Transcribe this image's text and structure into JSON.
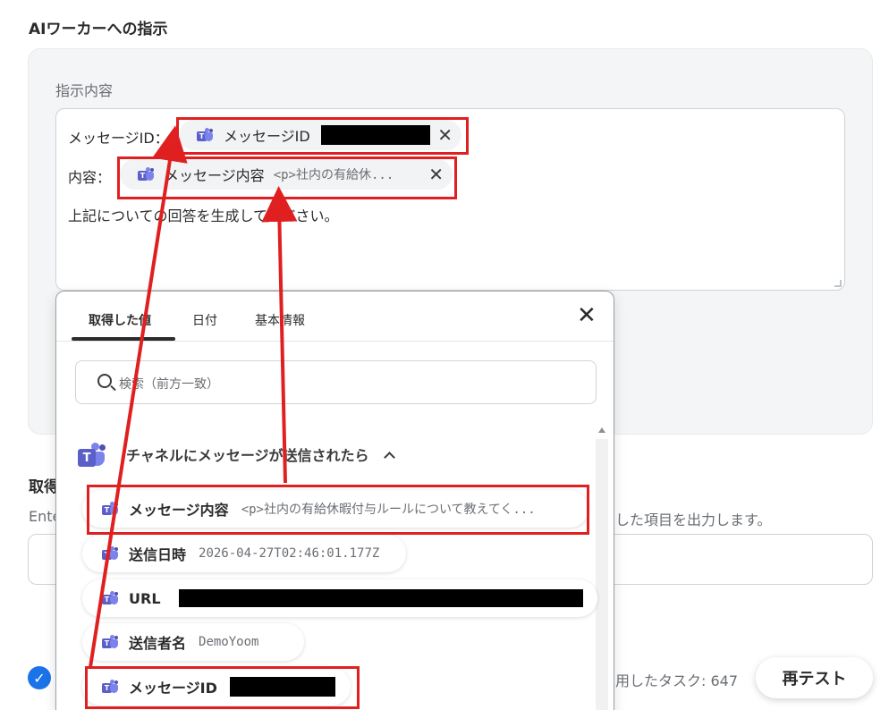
{
  "section_title": "AIワーカーへの指示",
  "instruction": {
    "label": "指示内容",
    "line1_label": "メッセージID：",
    "line2_label": "内容：",
    "chip_message_id": {
      "name": "メッセージID",
      "close": "✕"
    },
    "chip_message_content": {
      "name": "メッセージ内容",
      "value": "<p>社内の有給休...",
      "close": "✕"
    },
    "body_text": "上記についての回答を生成してください。"
  },
  "background": {
    "label": "取得",
    "desc_left": "Ente",
    "desc_right": "した項目を出力します。",
    "tasks": "用したタスク: 647",
    "retest_label": "再テスト",
    "check": "✓"
  },
  "popup": {
    "tabs": [
      {
        "label": "取得した値"
      },
      {
        "label": "日付"
      },
      {
        "label": "基本情報"
      }
    ],
    "close": "✕",
    "search_placeholder": "検索（前方一致）",
    "group_title": "チャネルにメッセージが送信されたら",
    "items": [
      {
        "name": "メッセージ内容",
        "value": "<p>社内の有給休暇付与ルールについて教えてく..."
      },
      {
        "name": "送信日時",
        "value": "2026-04-27T02:46:01.177Z"
      },
      {
        "name": "URL",
        "value": ""
      },
      {
        "name": "送信者名",
        "value": "DemoYoom"
      },
      {
        "name": "メッセージID",
        "value": ""
      }
    ]
  },
  "colors": {
    "accent_red": "#e02020",
    "teams_purple": "#5b5fc7",
    "check_blue": "#1a73e8"
  }
}
